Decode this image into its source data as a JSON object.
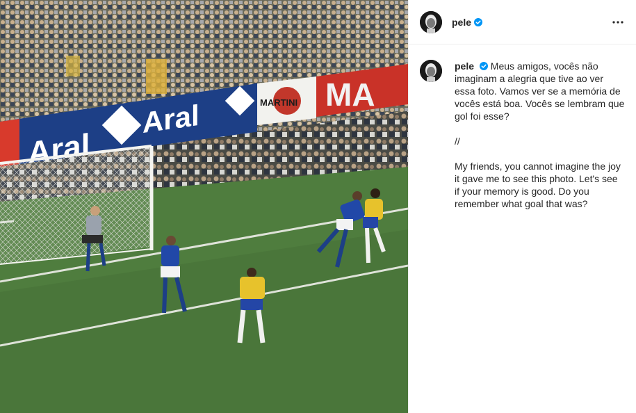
{
  "post": {
    "author": {
      "username": "pele",
      "verified": true,
      "avatar_icon": "profile-photo-avatar"
    },
    "more_options_icon": "more-options-icon",
    "caption": {
      "portuguese": "Meus amigos, vocês não imaginam a alegria que tive ao ver essa foto. Vamos ver se a memória de vocês está boa. Vocês se lembram que gol foi esse?",
      "separator": "//",
      "english": "My friends, you cannot imagine the joy it gave me to see this photo. Let's see if your memory is good. Do you remember what goal that was?"
    },
    "photo": {
      "ad_boards": [
        "Aral",
        "Aral",
        "MARTINI",
        "MA"
      ]
    }
  },
  "colors": {
    "verified": "#0095f6",
    "text": "#262626",
    "border": "#efefef"
  }
}
